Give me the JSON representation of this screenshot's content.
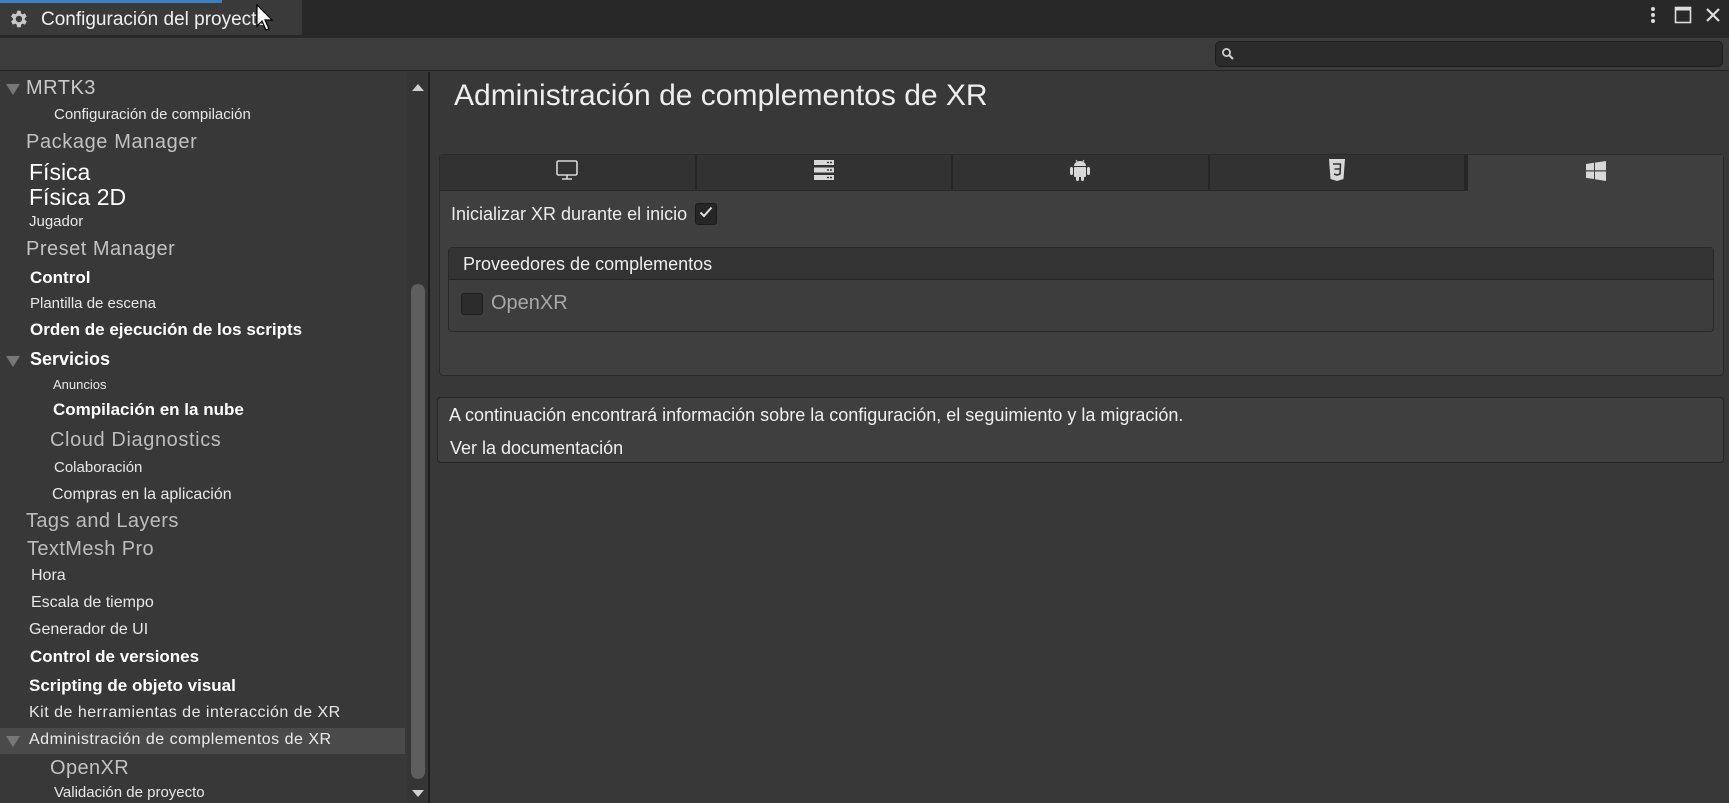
{
  "window": {
    "title": "Configuración del proyecto",
    "icon": "gear-icon",
    "buttons": [
      {
        "name": "more-options-button",
        "icon": "kebab-menu-icon"
      },
      {
        "name": "maximize-button",
        "icon": "maximize-icon"
      },
      {
        "name": "close-button",
        "icon": "close-icon"
      }
    ],
    "accent_color": "#3a7fc4"
  },
  "toolbar": {
    "search": {
      "placeholder": "",
      "value": "",
      "icon": "search-icon"
    }
  },
  "sidebar": {
    "items": [
      {
        "label": "MRTK3",
        "level": 0,
        "expandable": true,
        "expanded": true
      },
      {
        "label": "Configuración de compilación",
        "level": 1
      },
      {
        "label": "Package Manager",
        "level": 0
      },
      {
        "label": "Física",
        "level": 0
      },
      {
        "label": "Física 2D",
        "level": 0
      },
      {
        "label": "Jugador",
        "level": 0
      },
      {
        "label": "Preset Manager",
        "level": 0
      },
      {
        "label": "Control",
        "level": 0
      },
      {
        "label": "Plantilla de escena",
        "level": 0
      },
      {
        "label": "Orden de ejecución de los scripts",
        "level": 0
      },
      {
        "label": "Servicios",
        "level": 0,
        "expandable": true,
        "expanded": true
      },
      {
        "label": "Anuncios",
        "level": 1
      },
      {
        "label": "Compilación en la nube",
        "level": 1
      },
      {
        "label": "Cloud Diagnostics",
        "level": 1
      },
      {
        "label": "Colaboración",
        "level": 1
      },
      {
        "label": "Compras en la aplicación",
        "level": 1
      },
      {
        "label": "Tags and Layers",
        "level": 0
      },
      {
        "label": "TextMesh Pro",
        "level": 0
      },
      {
        "label": "Hora",
        "level": 0
      },
      {
        "label": "Escala de tiempo",
        "level": 0
      },
      {
        "label": "Generador de UI",
        "level": 0
      },
      {
        "label": "Control de versiones",
        "level": 0
      },
      {
        "label": "Scripting de objeto visual",
        "level": 0
      },
      {
        "label": "Kit de herramientas de interacción de XR",
        "level": 0
      },
      {
        "label": "Administración de complementos de XR",
        "level": 0,
        "expandable": true,
        "expanded": true,
        "selected": true
      },
      {
        "label": "OpenXR",
        "level": 1
      },
      {
        "label": "Validación de proyecto",
        "level": 1
      }
    ]
  },
  "main": {
    "title": "Administración de complementos de XR",
    "platform_tabs": [
      {
        "name": "standalone",
        "icon": "monitor-icon",
        "active": false
      },
      {
        "name": "dedicated-server",
        "icon": "server-icon",
        "active": false
      },
      {
        "name": "android",
        "icon": "android-icon",
        "active": false
      },
      {
        "name": "webgl",
        "icon": "html5-icon",
        "active": false
      },
      {
        "name": "windows-uwp",
        "icon": "windows-icon",
        "active": true
      }
    ],
    "init_xr": {
      "label": "Inicializar XR durante el inicio",
      "checked": true
    },
    "providers": {
      "title": "Proveedores de complementos",
      "items": [
        {
          "label": "OpenXR",
          "checked": false
        }
      ]
    },
    "info": {
      "text": "A continuación encontrará información sobre la configuración, el seguimiento y la migración.",
      "link": "Ver la documentación"
    }
  }
}
